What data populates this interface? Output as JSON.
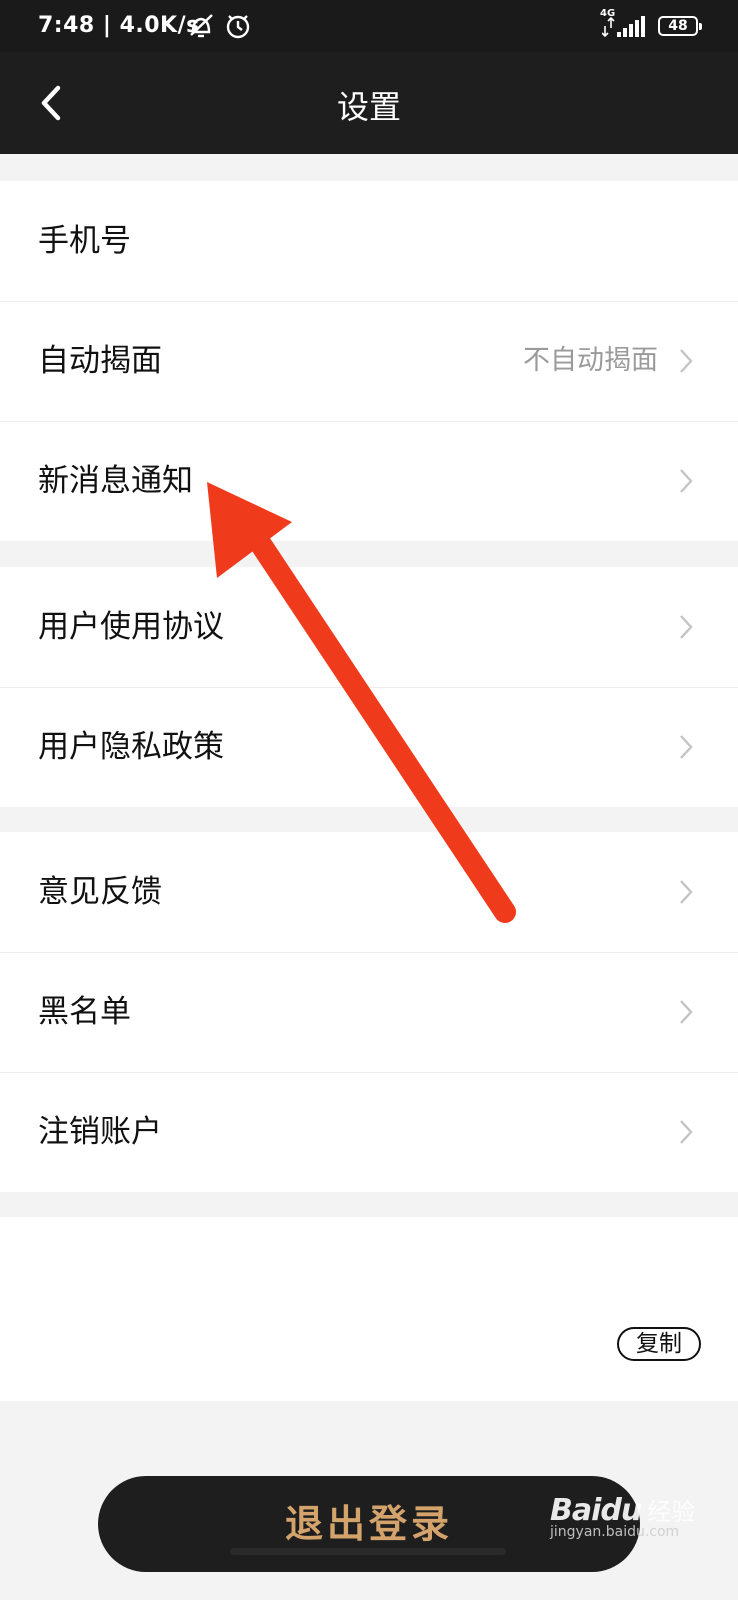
{
  "status_bar": {
    "time": "7:48 | 4.0K/s",
    "network": "4G",
    "battery": "48"
  },
  "nav": {
    "title": "设置"
  },
  "groups": [
    {
      "items": [
        {
          "label": "手机号",
          "value": ""
        },
        {
          "label": "自动揭面",
          "value": "不自动揭面"
        },
        {
          "label": "新消息通知",
          "value": ""
        }
      ]
    },
    {
      "items": [
        {
          "label": "用户使用协议",
          "value": ""
        },
        {
          "label": "用户隐私政策",
          "value": ""
        }
      ]
    },
    {
      "items": [
        {
          "label": "意见反馈",
          "value": ""
        },
        {
          "label": "黑名单",
          "value": ""
        },
        {
          "label": "注销账户",
          "value": ""
        }
      ]
    }
  ],
  "footer": {
    "copy_label": "复制",
    "logout_label": "退出登录"
  },
  "watermark": {
    "brand": "Baidu",
    "sub": "经验",
    "url": "jingyan.baidu.com"
  },
  "colors": {
    "annotation_arrow": "#f03a1c",
    "logout_text": "#d4a36b"
  }
}
